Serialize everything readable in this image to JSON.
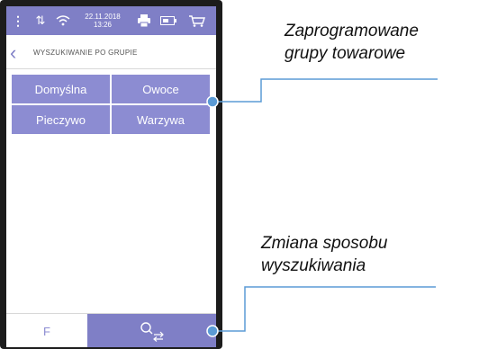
{
  "statusbar": {
    "menu_glyph": "⋮",
    "arrows_glyph": "⇅",
    "date": "22.11.2018",
    "time": "13:26"
  },
  "header": {
    "back_glyph": "‹",
    "title": "WYSZUKIWANIE PO GRUPIE"
  },
  "groups": [
    "Domyślna",
    "Owoce",
    "Pieczywo",
    "Warzywa"
  ],
  "bottom": {
    "f_label": "F"
  },
  "annotations": {
    "groups_line1": "Zaprogramowane",
    "groups_line2": "grupy towarowe",
    "search_line1": "Zmiana sposobu",
    "search_line2": "wyszukiwania"
  },
  "colors": {
    "accent": "#7f7fc6",
    "tile": "#8c8cd2",
    "callout": "#5b9bd5"
  }
}
